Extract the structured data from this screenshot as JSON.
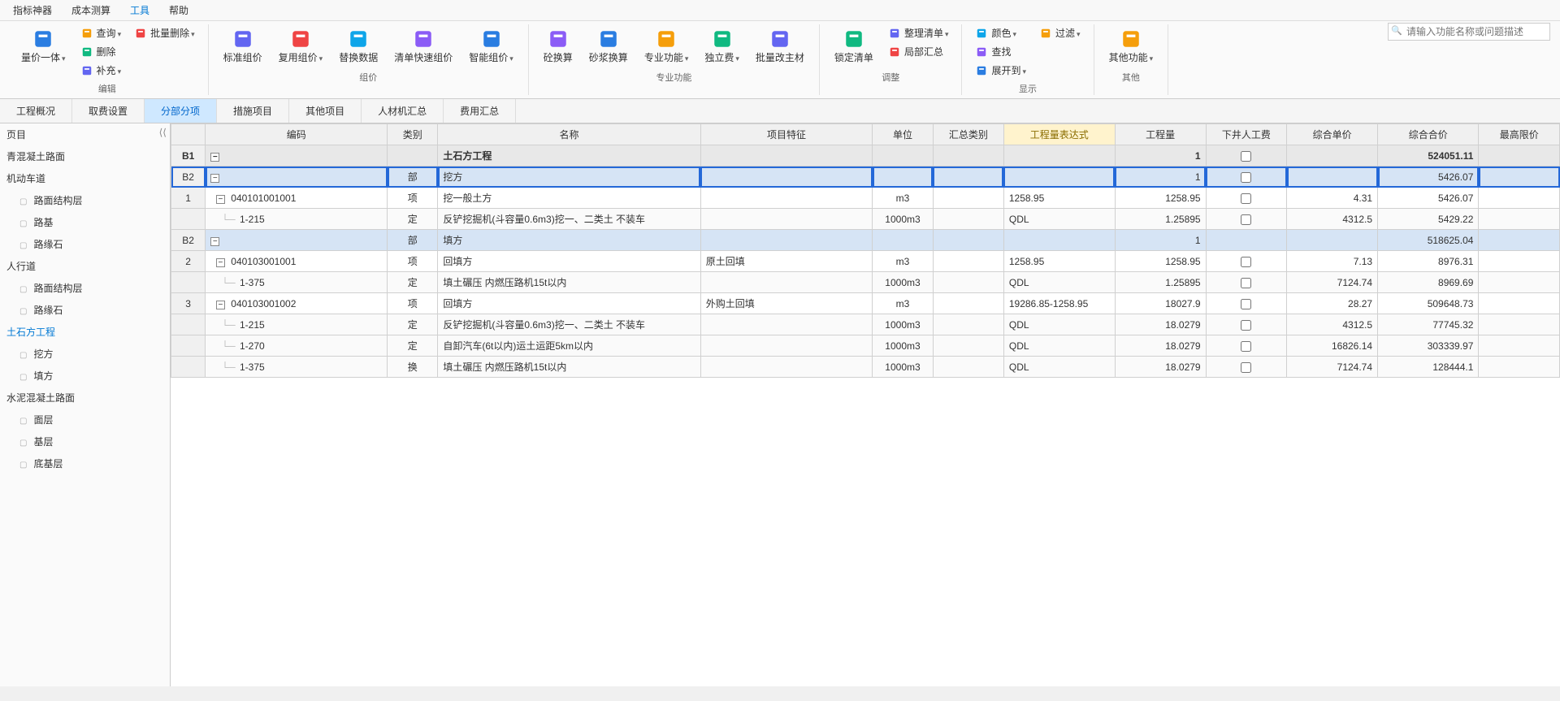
{
  "menu": {
    "items": [
      "指标神器",
      "成本测算",
      "工具",
      "帮助"
    ],
    "active_index": 2
  },
  "search": {
    "placeholder": "请输入功能名称或问题描述"
  },
  "ribbon": {
    "groups": [
      {
        "label": "编辑",
        "buttons": [
          {
            "name": "量价一体",
            "type": "lg-drop"
          },
          {
            "name": "查询",
            "type": "sm-drop"
          },
          {
            "name": "删除",
            "type": "sm"
          },
          {
            "name": "补充",
            "type": "sm-drop"
          },
          {
            "name": "批量删除",
            "type": "sm-drop"
          }
        ]
      },
      {
        "label": "组价",
        "buttons": [
          {
            "name": "标准组价",
            "type": "lg"
          },
          {
            "name": "复用组价",
            "type": "lg-drop"
          },
          {
            "name": "替换数据",
            "type": "lg"
          },
          {
            "name": "清单快速组价",
            "type": "lg"
          },
          {
            "name": "智能组价",
            "type": "lg-drop"
          }
        ]
      },
      {
        "label": "专业功能",
        "buttons": [
          {
            "name": "砼换算",
            "type": "lg"
          },
          {
            "name": "砂浆换算",
            "type": "lg"
          },
          {
            "name": "专业功能",
            "type": "lg-drop"
          },
          {
            "name": "独立费",
            "type": "lg-drop"
          },
          {
            "name": "批量改主材",
            "type": "lg"
          }
        ]
      },
      {
        "label": "调整",
        "buttons": [
          {
            "name": "锁定清单",
            "type": "lg"
          },
          {
            "name": "整理清单",
            "type": "sm-drop"
          },
          {
            "name": "局部汇总",
            "type": "sm"
          }
        ]
      },
      {
        "label": "显示",
        "buttons": [
          {
            "name": "颜色",
            "type": "sm-drop"
          },
          {
            "name": "查找",
            "type": "sm"
          },
          {
            "name": "展开到",
            "type": "sm-drop"
          },
          {
            "name": "过滤",
            "type": "sm-drop"
          }
        ]
      },
      {
        "label": "其他",
        "buttons": [
          {
            "name": "其他功能",
            "type": "lg-drop"
          }
        ]
      }
    ]
  },
  "tabs": {
    "items": [
      "工程概况",
      "取费设置",
      "分部分项",
      "措施项目",
      "其他项目",
      "人材机汇总",
      "费用汇总"
    ],
    "active_index": 2
  },
  "sidebar": {
    "items": [
      {
        "label": "页目",
        "level": 1
      },
      {
        "label": "青混凝土路面",
        "level": 1
      },
      {
        "label": "机动车道",
        "level": 1
      },
      {
        "label": "路面结构层",
        "level": 2,
        "doc": true
      },
      {
        "label": "路基",
        "level": 2,
        "doc": true
      },
      {
        "label": "路缘石",
        "level": 2,
        "doc": true
      },
      {
        "label": "人行道",
        "level": 1
      },
      {
        "label": "路面结构层",
        "level": 2,
        "doc": true
      },
      {
        "label": "路缘石",
        "level": 2,
        "doc": true
      },
      {
        "label": "土石方工程",
        "level": 1,
        "active": true
      },
      {
        "label": "挖方",
        "level": 2,
        "doc": true
      },
      {
        "label": "填方",
        "level": 2,
        "doc": true
      },
      {
        "label": "水泥混凝土路面",
        "level": 1
      },
      {
        "label": "面层",
        "level": 2,
        "doc": true
      },
      {
        "label": "基层",
        "level": 2,
        "doc": true
      },
      {
        "label": "底基层",
        "level": 2,
        "doc": true
      }
    ]
  },
  "grid": {
    "columns": [
      "",
      "编码",
      "类别",
      "名称",
      "项目特征",
      "单位",
      "汇总类别",
      "工程量表达式",
      "工程量",
      "下井人工费",
      "综合单价",
      "综合合价",
      "最高限价"
    ],
    "active_col": 7,
    "rows": [
      {
        "kind": "b1",
        "head": "B1",
        "cat": "",
        "name": "土石方工程",
        "qty": "1",
        "chk": false,
        "total": "524051.11"
      },
      {
        "kind": "b2",
        "head": "B2",
        "selected": true,
        "cat": "部",
        "name": "挖方",
        "qty": "1",
        "chk": false,
        "total": "5426.07"
      },
      {
        "kind": "item",
        "head": "1",
        "code": "040101001001",
        "cat": "项",
        "name": "挖一般土方",
        "unit": "m3",
        "expr": "1258.95",
        "qty": "1258.95",
        "chk": false,
        "price": "4.31",
        "total": "5426.07"
      },
      {
        "kind": "quota",
        "code": "1-215",
        "cat": "定",
        "name": "反铲挖掘机(斗容量0.6m3)挖一、二类土 不装车",
        "unit": "1000m3",
        "expr": "QDL",
        "qty": "1.25895",
        "chk": false,
        "price": "4312.5",
        "total": "5429.22"
      },
      {
        "kind": "b2",
        "head": "B2",
        "cat": "部",
        "name": "填方",
        "qty": "1",
        "total": "518625.04"
      },
      {
        "kind": "item",
        "head": "2",
        "code": "040103001001",
        "cat": "项",
        "name": "回填方",
        "feat": "原土回填",
        "unit": "m3",
        "expr": "1258.95",
        "qty": "1258.95",
        "chk": false,
        "price": "7.13",
        "total": "8976.31"
      },
      {
        "kind": "quota",
        "code": "1-375",
        "cat": "定",
        "name": "填土碾压 内燃压路机15t以内",
        "unit": "1000m3",
        "expr": "QDL",
        "qty": "1.25895",
        "chk": false,
        "price": "7124.74",
        "total": "8969.69"
      },
      {
        "kind": "item",
        "head": "3",
        "code": "040103001002",
        "cat": "项",
        "name": "回填方",
        "feat": "外购土回填",
        "unit": "m3",
        "expr": "19286.85-1258.95",
        "qty": "18027.9",
        "chk": false,
        "price": "28.27",
        "total": "509648.73"
      },
      {
        "kind": "quota",
        "code": "1-215",
        "cat": "定",
        "name": "反铲挖掘机(斗容量0.6m3)挖一、二类土 不装车",
        "unit": "1000m3",
        "expr": "QDL",
        "qty": "18.0279",
        "chk": false,
        "price": "4312.5",
        "total": "77745.32"
      },
      {
        "kind": "quota",
        "code": "1-270",
        "cat": "定",
        "name": "自卸汽车(6t以内)运土运距5km以内",
        "unit": "1000m3",
        "expr": "QDL",
        "qty": "18.0279",
        "chk": false,
        "price": "16826.14",
        "total": "303339.97"
      },
      {
        "kind": "quota",
        "code": "1-375",
        "cat": "换",
        "name": "填土碾压 内燃压路机15t以内",
        "unit": "1000m3",
        "expr": "QDL",
        "qty": "18.0279",
        "chk": false,
        "price": "7124.74",
        "total": "128444.1"
      }
    ]
  }
}
